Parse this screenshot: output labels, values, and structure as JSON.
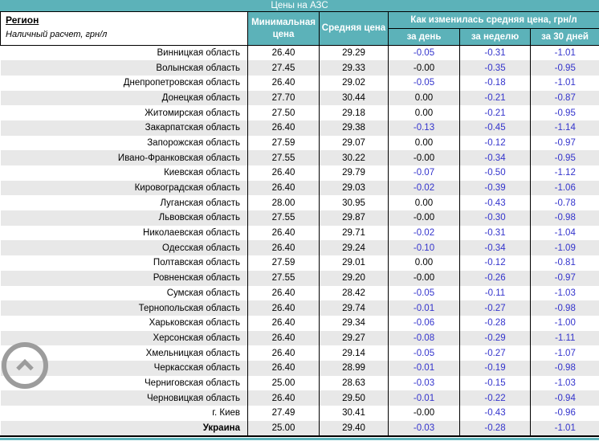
{
  "title": "Цены на АЗС",
  "header": {
    "region_title": "Регион",
    "region_subtitle": "Наличный расчет, грн/л",
    "min_price": "Минимальная цена",
    "avg_price": "Средняя цена",
    "change_title": "Как изменилась средняя цена, грн/л",
    "change_day": "за день",
    "change_week": "за неделю",
    "change_month": "за 30 дней"
  },
  "colors": {
    "teal": "#5cb2b9",
    "stripe": "#e8e8e8",
    "negative": "#3333cc",
    "scroll_button": "#9c9c9c"
  },
  "icons": {
    "scroll_top": "chevron-up-icon"
  },
  "chart_data": {
    "type": "table",
    "title": "Цены на АЗС",
    "columns": [
      "Регион",
      "Минимальная цена",
      "Средняя цена",
      "за день",
      "за неделю",
      "за 30 дней"
    ],
    "change_group_label": "Как изменилась средняя цена, грн/л",
    "region_note": "Наличный расчет, грн/л",
    "rows": [
      [
        "Винницкая область",
        "26.40",
        "29.29",
        "-0.05",
        "-0.31",
        "-1.01"
      ],
      [
        "Волынская область",
        "27.45",
        "29.33",
        "-0.00",
        "-0.35",
        "-0.95"
      ],
      [
        "Днепропетровская область",
        "26.40",
        "29.02",
        "-0.05",
        "-0.18",
        "-1.01"
      ],
      [
        "Донецкая область",
        "27.70",
        "30.44",
        "0.00",
        "-0.21",
        "-0.87"
      ],
      [
        "Житомирская область",
        "27.50",
        "29.18",
        "0.00",
        "-0.21",
        "-0.95"
      ],
      [
        "Закарпатская область",
        "26.40",
        "29.38",
        "-0.13",
        "-0.45",
        "-1.14"
      ],
      [
        "Запорожская область",
        "27.59",
        "29.07",
        "0.00",
        "-0.12",
        "-0.97"
      ],
      [
        "Ивано-Франковская область",
        "27.55",
        "30.22",
        "-0.00",
        "-0.34",
        "-0.95"
      ],
      [
        "Киевская область",
        "26.40",
        "29.79",
        "-0.07",
        "-0.50",
        "-1.12"
      ],
      [
        "Кировоградская область",
        "26.40",
        "29.03",
        "-0.02",
        "-0.39",
        "-1.06"
      ],
      [
        "Луганская область",
        "28.00",
        "30.95",
        "0.00",
        "-0.43",
        "-0.78"
      ],
      [
        "Львовская область",
        "27.55",
        "29.87",
        "-0.00",
        "-0.30",
        "-0.98"
      ],
      [
        "Николаевская область",
        "26.40",
        "29.71",
        "-0.02",
        "-0.31",
        "-1.04"
      ],
      [
        "Одесская область",
        "26.40",
        "29.24",
        "-0.10",
        "-0.34",
        "-1.09"
      ],
      [
        "Полтавская область",
        "27.59",
        "29.01",
        "0.00",
        "-0.12",
        "-0.81"
      ],
      [
        "Ровненская область",
        "27.55",
        "29.20",
        "-0.00",
        "-0.26",
        "-0.97"
      ],
      [
        "Сумская область",
        "26.40",
        "28.42",
        "-0.05",
        "-0.11",
        "-1.03"
      ],
      [
        "Тернопольская область",
        "26.40",
        "29.74",
        "-0.01",
        "-0.27",
        "-0.98"
      ],
      [
        "Харьковская область",
        "26.40",
        "29.34",
        "-0.06",
        "-0.28",
        "-1.00"
      ],
      [
        "Херсонская область",
        "26.40",
        "29.27",
        "-0.08",
        "-0.29",
        "-1.11"
      ],
      [
        "Хмельницкая область",
        "26.40",
        "29.14",
        "-0.05",
        "-0.27",
        "-1.07"
      ],
      [
        "Черкасская область",
        "26.40",
        "28.99",
        "-0.01",
        "-0.19",
        "-0.98"
      ],
      [
        "Черниговская область",
        "25.00",
        "28.63",
        "-0.03",
        "-0.15",
        "-1.03"
      ],
      [
        "Черновицкая область",
        "26.40",
        "29.50",
        "-0.01",
        "-0.22",
        "-0.94"
      ],
      [
        "г. Киев",
        "27.49",
        "30.41",
        "-0.00",
        "-0.43",
        "-0.96"
      ],
      [
        "Украина",
        "25.00",
        "29.40",
        "-0.03",
        "-0.28",
        "-1.01"
      ]
    ]
  }
}
